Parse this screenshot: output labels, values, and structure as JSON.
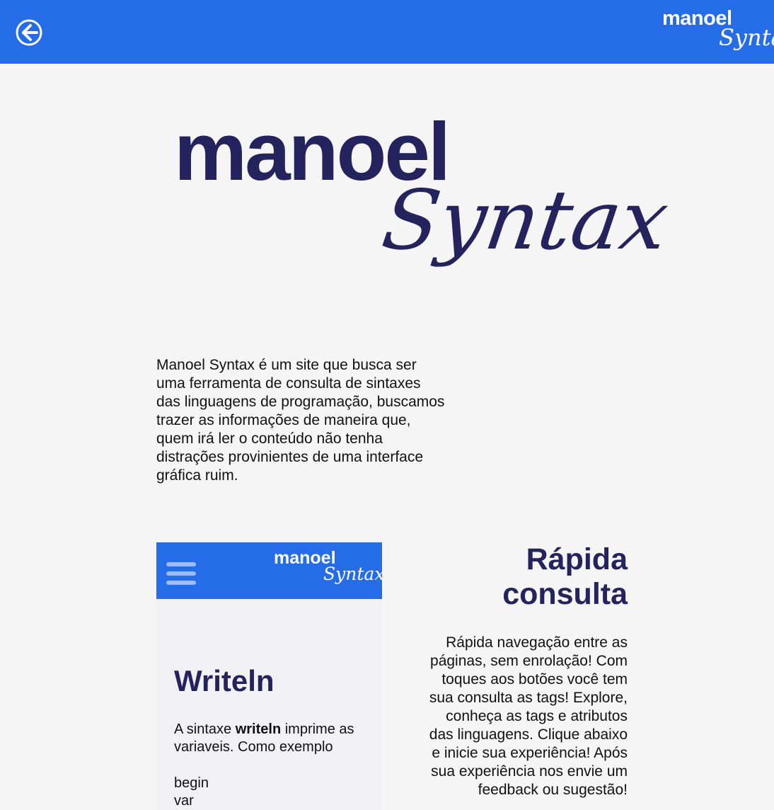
{
  "header": {
    "back_icon": "arrow-left-circle-icon",
    "logo_line1": "manoel",
    "logo_line2": "Syntax",
    "bar_color": "#256ce8"
  },
  "hero": {
    "logo_line1": "manoel",
    "logo_line2": "Syntax",
    "logo_color": "#25235e"
  },
  "intro": {
    "text": "Manoel Syntax é um site que busca ser uma ferramenta de consulta de sintaxes das linguagens de programação, buscamos trazer as informações de maneira que, quem irá ler o conteúdo não tenha distrações provinientes de uma interface gráfica ruim."
  },
  "preview": {
    "menu_icon": "hamburger-menu-icon",
    "logo_line1": "manoel",
    "logo_line2": "Syntax",
    "title": "Writeln",
    "text_before": "A sintaxe ",
    "text_bold": "writeln",
    "text_after": " imprime as variaveis. Como exemplo",
    "code_line1": "begin",
    "code_line2": "var"
  },
  "feature": {
    "title": "Rápida consulta",
    "text": "Rápida navegação entre as páginas, sem enrolação! Com toques aos botões você tem sua consulta as tags! Explore, conheça as tags e atributos das linguagens. Clique abaixo e inicie sua experiência! Após sua experiência nos envie um feedback ou sugestão!"
  }
}
